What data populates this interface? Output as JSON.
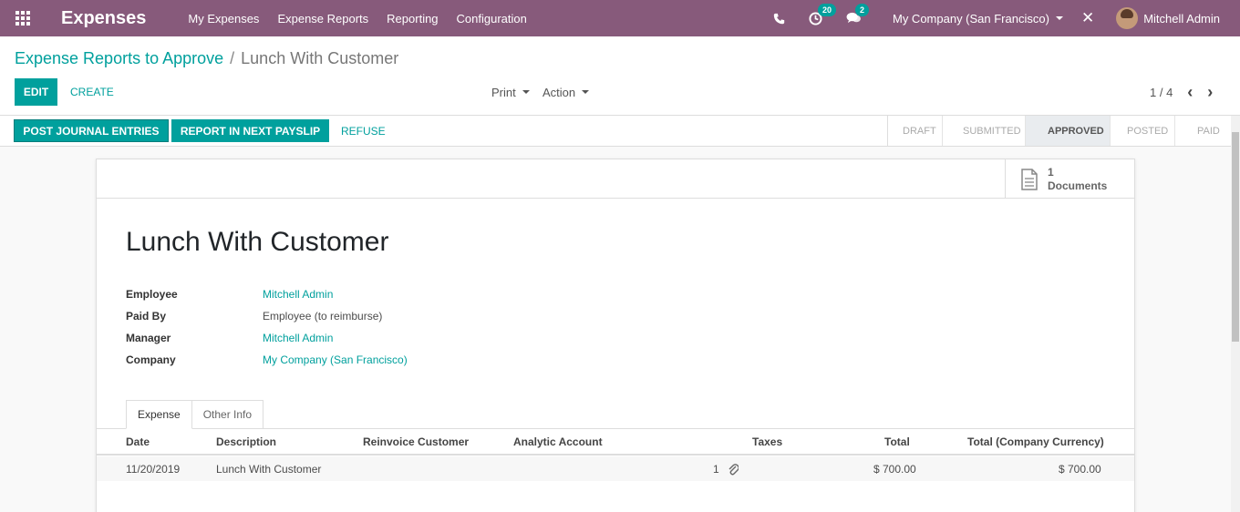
{
  "navbar": {
    "brand": "Expenses",
    "menu": [
      "My Expenses",
      "Expense Reports",
      "Reporting",
      "Configuration"
    ],
    "activities_count": "20",
    "messages_count": "2",
    "company": "My Company (San Francisco)",
    "user": "Mitchell Admin",
    "colors": {
      "bar": "#875a7b",
      "badge": "#00a09d"
    }
  },
  "breadcrumb": {
    "parent": "Expense Reports to Approve",
    "separator": "/",
    "current": "Lunch With Customer"
  },
  "toolbar": {
    "edit_label": "EDIT",
    "create_label": "CREATE",
    "print_label": "Print",
    "action_label": "Action",
    "pager": "1 / 4"
  },
  "statusbar": {
    "post_label": "POST JOURNAL ENTRIES",
    "payslip_label": "REPORT IN NEXT PAYSLIP",
    "refuse_label": "REFUSE",
    "stages": [
      "DRAFT",
      "SUBMITTED",
      "APPROVED",
      "POSTED",
      "PAID"
    ],
    "active_stage": "APPROVED"
  },
  "sheet": {
    "documents_count": "1",
    "documents_label": "Documents",
    "title": "Lunch With Customer",
    "fields": [
      {
        "label": "Employee",
        "value": "Mitchell Admin",
        "link": true
      },
      {
        "label": "Paid By",
        "value": "Employee (to reimburse)",
        "link": false
      },
      {
        "label": "Manager",
        "value": "Mitchell Admin",
        "link": true
      },
      {
        "label": "Company",
        "value": "My Company (San Francisco)",
        "link": true
      }
    ],
    "tabs": [
      "Expense",
      "Other Info"
    ],
    "active_tab": "Expense",
    "table": {
      "columns": [
        "Date",
        "Description",
        "Reinvoice Customer",
        "Analytic Account",
        "Taxes",
        "Total",
        "Total (Company Currency)"
      ],
      "rows": [
        {
          "date": "11/20/2019",
          "description": "Lunch With Customer",
          "reinvoice_customer": "",
          "analytic_account": "",
          "attachments": "1",
          "taxes": "",
          "total": "$ 700.00",
          "total_company": "$ 700.00"
        }
      ]
    }
  }
}
